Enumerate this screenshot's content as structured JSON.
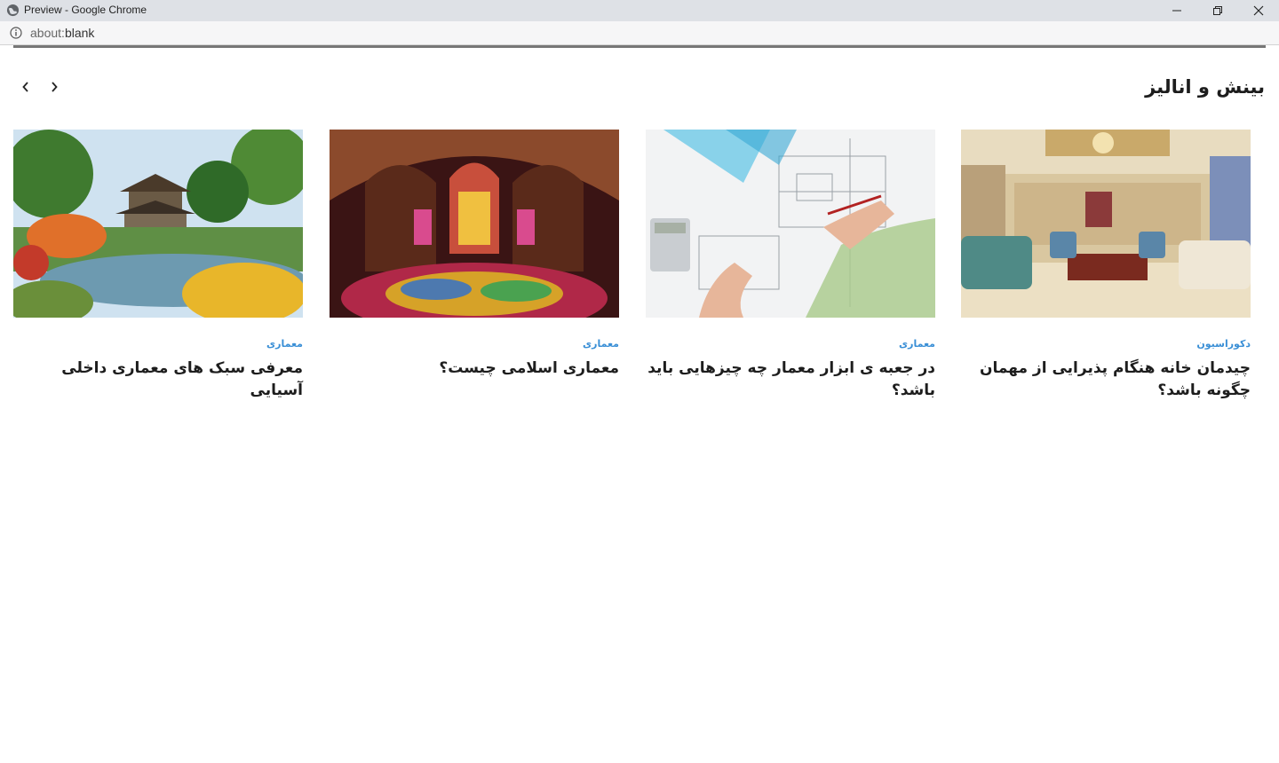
{
  "window": {
    "title": "Preview - Google Chrome"
  },
  "address": {
    "prefix": "about:",
    "host": "blank"
  },
  "section": {
    "title": "بینش و انالیز"
  },
  "cards": [
    {
      "category": "دکوراسیون",
      "title": "چیدمان خانه هنگام پذیرایی از مهمان چگونه باشد؟"
    },
    {
      "category": "معماری",
      "title": "در جعبه ی ابزار معمار چه چیزهایی باید باشد؟"
    },
    {
      "category": "معماری",
      "title": "معماری اسلامی چیست؟"
    },
    {
      "category": "معماری",
      "title": "معرفی سبک های معماری داخلی آسیایی"
    }
  ],
  "colors": {
    "category": "#3a8fd6",
    "titlebar": "#dee1e6"
  }
}
